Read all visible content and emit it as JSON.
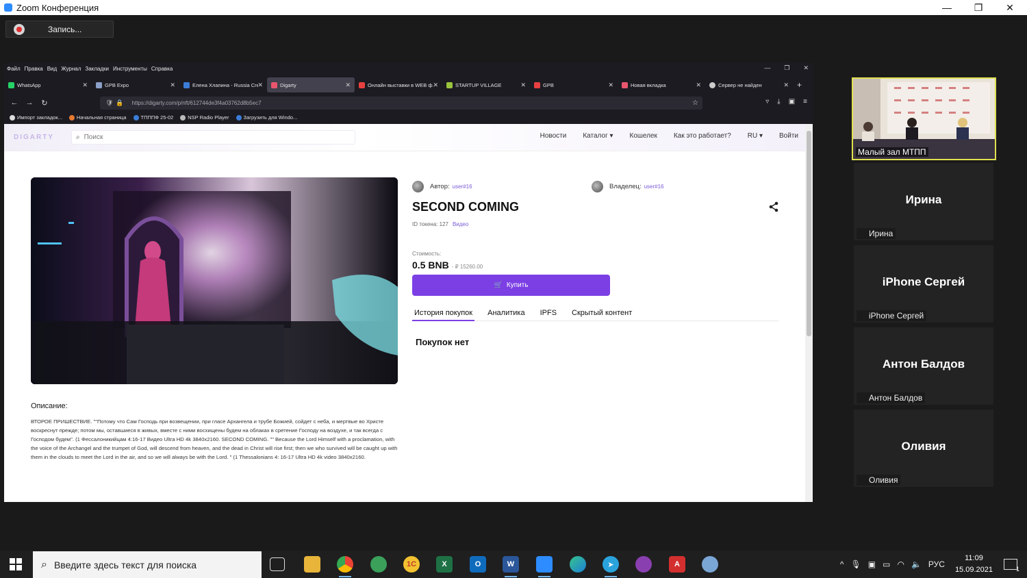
{
  "zoom": {
    "title": "Zoom Конференция",
    "record_label": "Запись..."
  },
  "browser": {
    "menu": [
      "Файл",
      "Правка",
      "Вид",
      "Журнал",
      "Закладки",
      "Инструменты",
      "Справка"
    ],
    "tabs": [
      {
        "label": "WhatsApp",
        "color": "#25d366"
      },
      {
        "label": "GPB Expo",
        "color": "#8aa0c8"
      },
      {
        "label": "Елена Хлапина - Russia Cre…",
        "color": "#3b7dd8"
      },
      {
        "label": "Digarty",
        "color": "#e8556d",
        "active": true
      },
      {
        "label": "Онлайн выставки в WEB ф…",
        "color": "#e84040"
      },
      {
        "label": "STARTUP VILLAGE",
        "color": "#9ac43c"
      },
      {
        "label": "GPB",
        "color": "#e84040"
      },
      {
        "label": "Новая вкладка",
        "color": "#e8556d"
      },
      {
        "label": "Сервер не найден",
        "color": "#cccccc"
      }
    ],
    "url": "https://digarty.com/p/nft/612744de3f4a03762d8b5ec7",
    "bookmarks": [
      {
        "label": "Импорт закладок...",
        "color": "#dddddd"
      },
      {
        "label": "Начальная страница",
        "color": "#e87a30"
      },
      {
        "label": "ТПППФ 25-02",
        "color": "#3b7dd8"
      },
      {
        "label": "NSP Radio Player",
        "color": "#bbbbbb"
      },
      {
        "label": "Загрузить для Windo...",
        "color": "#3b7dd8"
      }
    ]
  },
  "site": {
    "logo": "DIGARTY",
    "search_placeholder": "Поиск",
    "nav": [
      "Новости",
      "Каталог ▾",
      "Кошелек",
      "Как это работает?",
      "RU ▾",
      "Войти"
    ]
  },
  "nft": {
    "author_label": "Автор:",
    "author": "user#16",
    "owner_label": "Владелец:",
    "owner": "user#16",
    "title": "SECOND COMING",
    "token_id": "ID токена: 127",
    "type": "Видео",
    "cost_label": "Стоимость:",
    "price": "0.5 BNB",
    "price_rub": "- ₽ 15260.00",
    "buy_label": "Купить",
    "tabs": [
      "История покупок",
      "Аналитика",
      "IPFS",
      "Скрытый контент"
    ],
    "no_purchases": "Покупок нет",
    "desc_title": "Описание:",
    "description": "ВТОРОЕ ПРИШЕСТВИЕ. \"\"Потому что Сам Господь при возвещении, при гласе Архангела и трубе Божией, сойдет с неба, и мертвые во Христе воскреснут прежде; потом мы, оставшиеся в живых, вместе с ними восхищены будем на облаках в сретение Господу на воздухе, и так всегда с Господом будем\". (1 Фессалоникийцам 4:16-17 Видео Ultra HD 4k 3840x2160. SECOND COMING. \"\" Because the Lord Himself with a proclamation, with the voice of the Archangel and the trumpet of God, will descend from heaven, and the dead in Christ will rise first; then we who survived will be caught up with them in the clouds to meet the Lord in the air, and so we will always be with the Lord. \" (1 Thessalonians 4: 16-17 Ultra HD 4k video 3840x2160."
  },
  "participants": {
    "video_name": "Малый зал МТПП",
    "tiles": [
      {
        "big": "Ирина",
        "small": "Ирина"
      },
      {
        "big": "iPhone Сергей",
        "small": "iPhone Сергей"
      },
      {
        "big": "Антон Балдов",
        "small": "Антон Балдов"
      },
      {
        "big": "Оливия",
        "small": "Оливия"
      }
    ]
  },
  "taskbar": {
    "search_placeholder": "Введите здесь текст для поиска",
    "lang": "РУС",
    "time": "11:09",
    "date": "15.09.2021",
    "notifications": "1"
  }
}
